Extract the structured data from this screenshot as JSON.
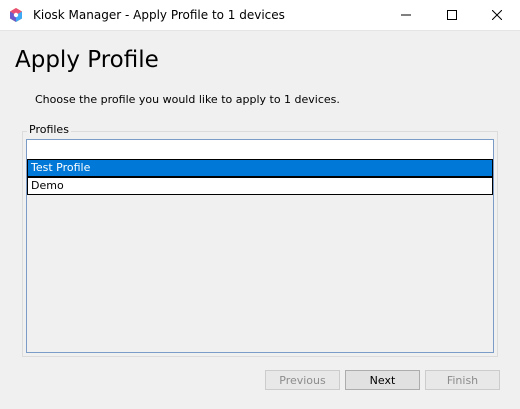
{
  "window": {
    "title": "Kiosk Manager - Apply Profile to 1 devices",
    "app_icon": "kiosk-manager-icon",
    "controls": {
      "minimize_icon": "minimize-icon",
      "maximize_icon": "maximize-icon",
      "close_icon": "close-icon"
    }
  },
  "page": {
    "heading": "Apply Profile",
    "instruction": "Choose the profile you would like to apply to 1 devices."
  },
  "profiles": {
    "group_label": "Profiles",
    "items": [
      {
        "label": "Test Profile",
        "selected": true
      },
      {
        "label": "Demo",
        "selected": false
      }
    ]
  },
  "footer": {
    "previous_label": "Previous",
    "previous_enabled": false,
    "next_label": "Next",
    "next_enabled": true,
    "finish_label": "Finish",
    "finish_enabled": false
  },
  "colors": {
    "selection": "#0078d7",
    "window_bg": "#f0f0f0"
  }
}
